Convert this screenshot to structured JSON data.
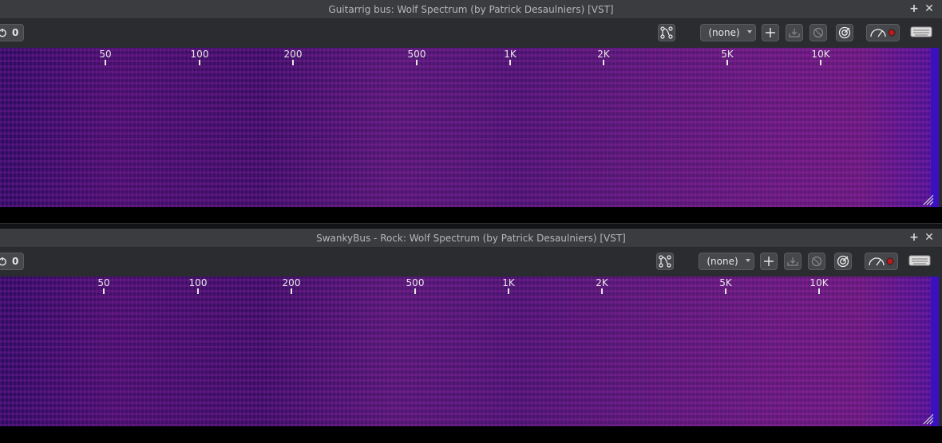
{
  "windows": [
    {
      "title": "Guitarrig bus: Wolf Spectrum (by Patrick Desaulniers) [VST]",
      "counter": "0",
      "preset": "(none)",
      "freq_labels": [
        "50",
        "100",
        "200",
        "500",
        "1K",
        "2K",
        "5K",
        "10K"
      ]
    },
    {
      "title": "SwankyBus - Rock: Wolf Spectrum (by Patrick Desaulniers) [VST]",
      "counter": "0",
      "preset": "(none)",
      "freq_labels": [
        "50",
        "100",
        "200",
        "500",
        "1K",
        "2K",
        "5K",
        "10K"
      ]
    }
  ],
  "icons": {
    "title_add": "+",
    "title_close": "✕"
  },
  "colors": {
    "spectrum_base": "#3c0f6a",
    "spectrum_hot": "#8a2a9a",
    "titlebar": "#3b3c3f",
    "toolbar": "#2b2c2f"
  }
}
